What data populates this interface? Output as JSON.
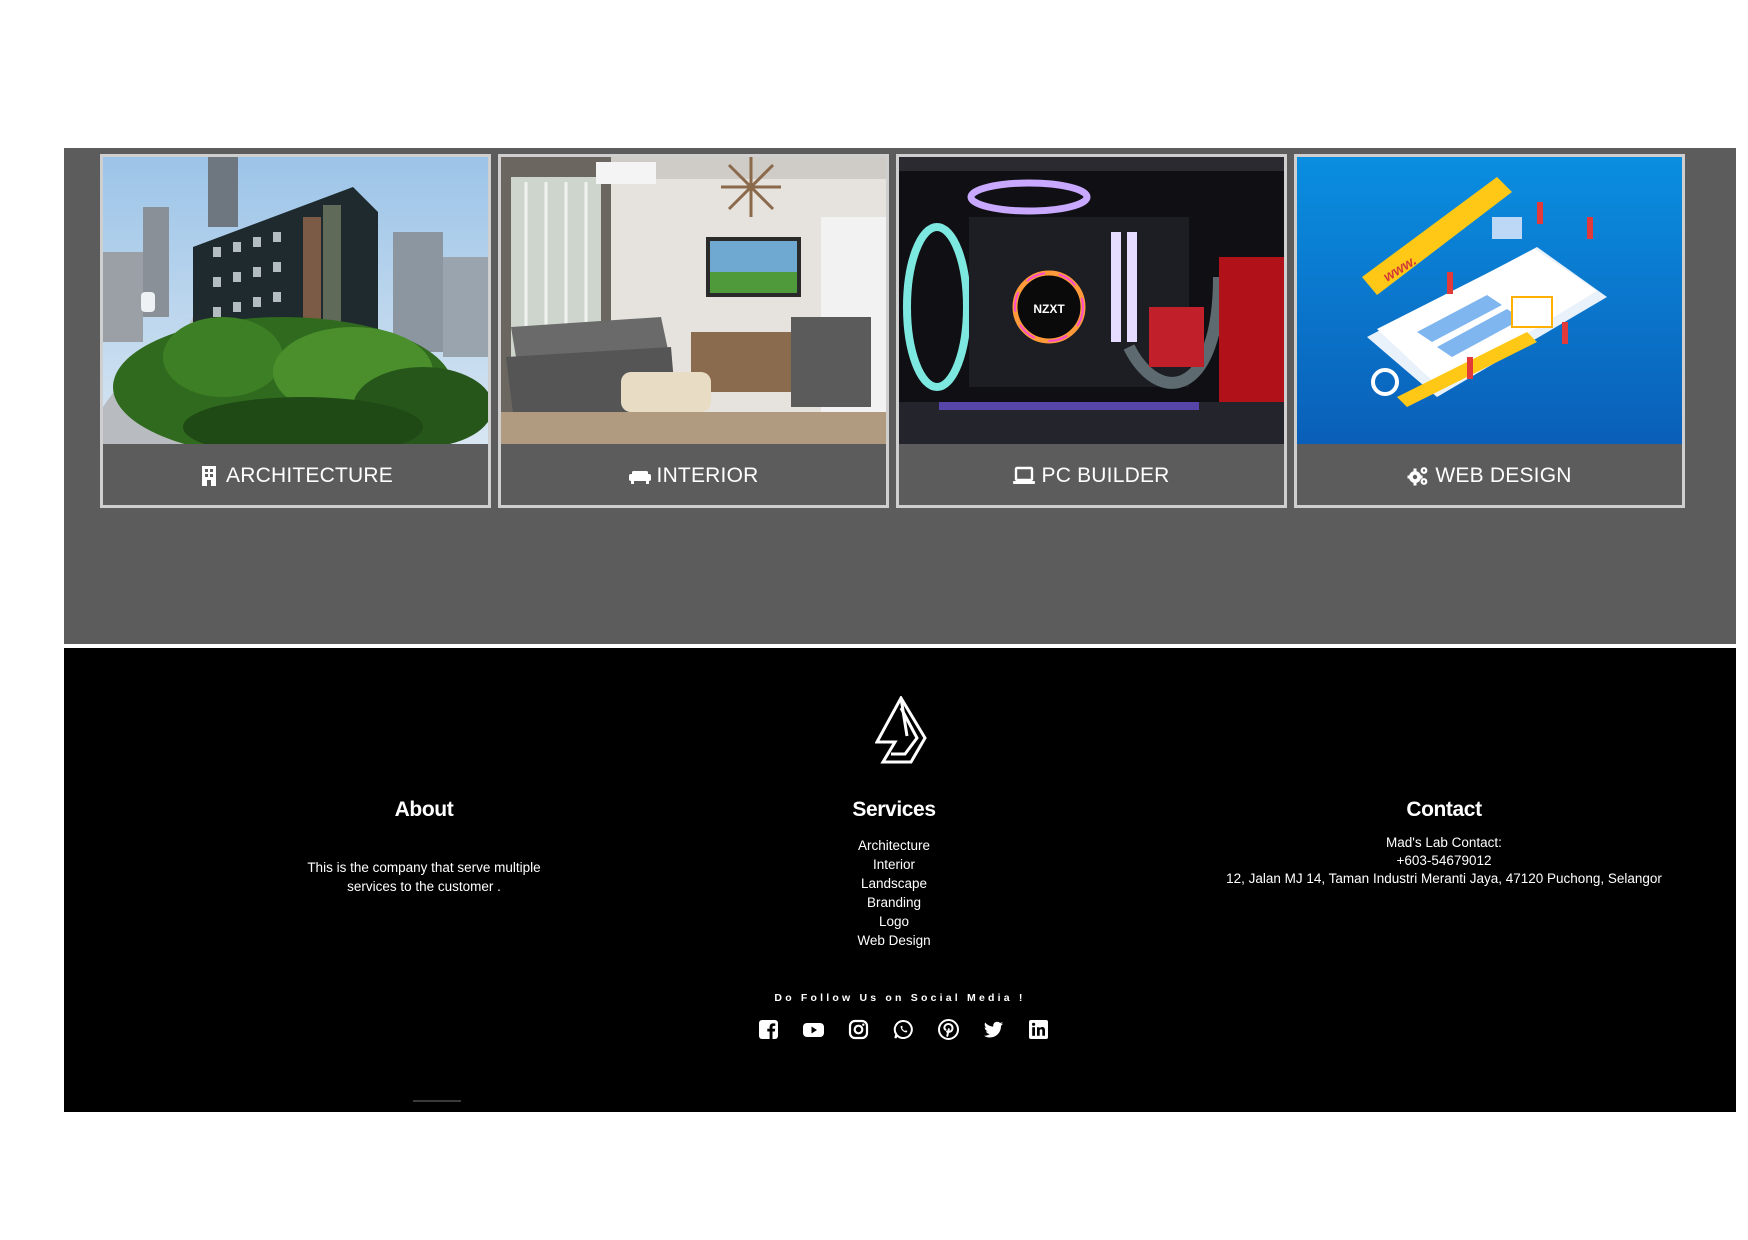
{
  "services": {
    "cards": [
      {
        "label": "ARCHITECTURE",
        "icon": "building-icon"
      },
      {
        "label": "INTERIOR",
        "icon": "couch-icon"
      },
      {
        "label": "PC BUILDER",
        "icon": "laptop-icon"
      },
      {
        "label": "WEB DESIGN",
        "icon": "cogs-icon"
      }
    ],
    "thumb_badges": {
      "pc": "NZXT",
      "web": "www."
    }
  },
  "footer": {
    "about": {
      "title": "About",
      "text_line1": "This is the company that serve multiple",
      "text_line2": "services to the customer ."
    },
    "services": {
      "title": "Services",
      "items": [
        "Architecture",
        "Interior",
        "Landscape",
        "Branding",
        "Logo",
        "Web Design"
      ]
    },
    "contact": {
      "title": "Contact",
      "line1": "Mad's Lab Contact:",
      "phone": "+603-54679012",
      "address": "12, Jalan MJ 14, Taman Industri Meranti Jaya, 47120 Puchong, Selangor"
    },
    "follow_text": "Do Follow Us on Social Media !",
    "social": [
      "facebook-icon",
      "youtube-icon",
      "instagram-icon",
      "whatsapp-icon",
      "pinterest-icon",
      "twitter-icon",
      "linkedin-icon"
    ]
  },
  "colors": {
    "band_bg": "#5c5c5c",
    "footer_bg": "#000000",
    "card_border": "#cfcfcf",
    "text": "#ffffff"
  }
}
